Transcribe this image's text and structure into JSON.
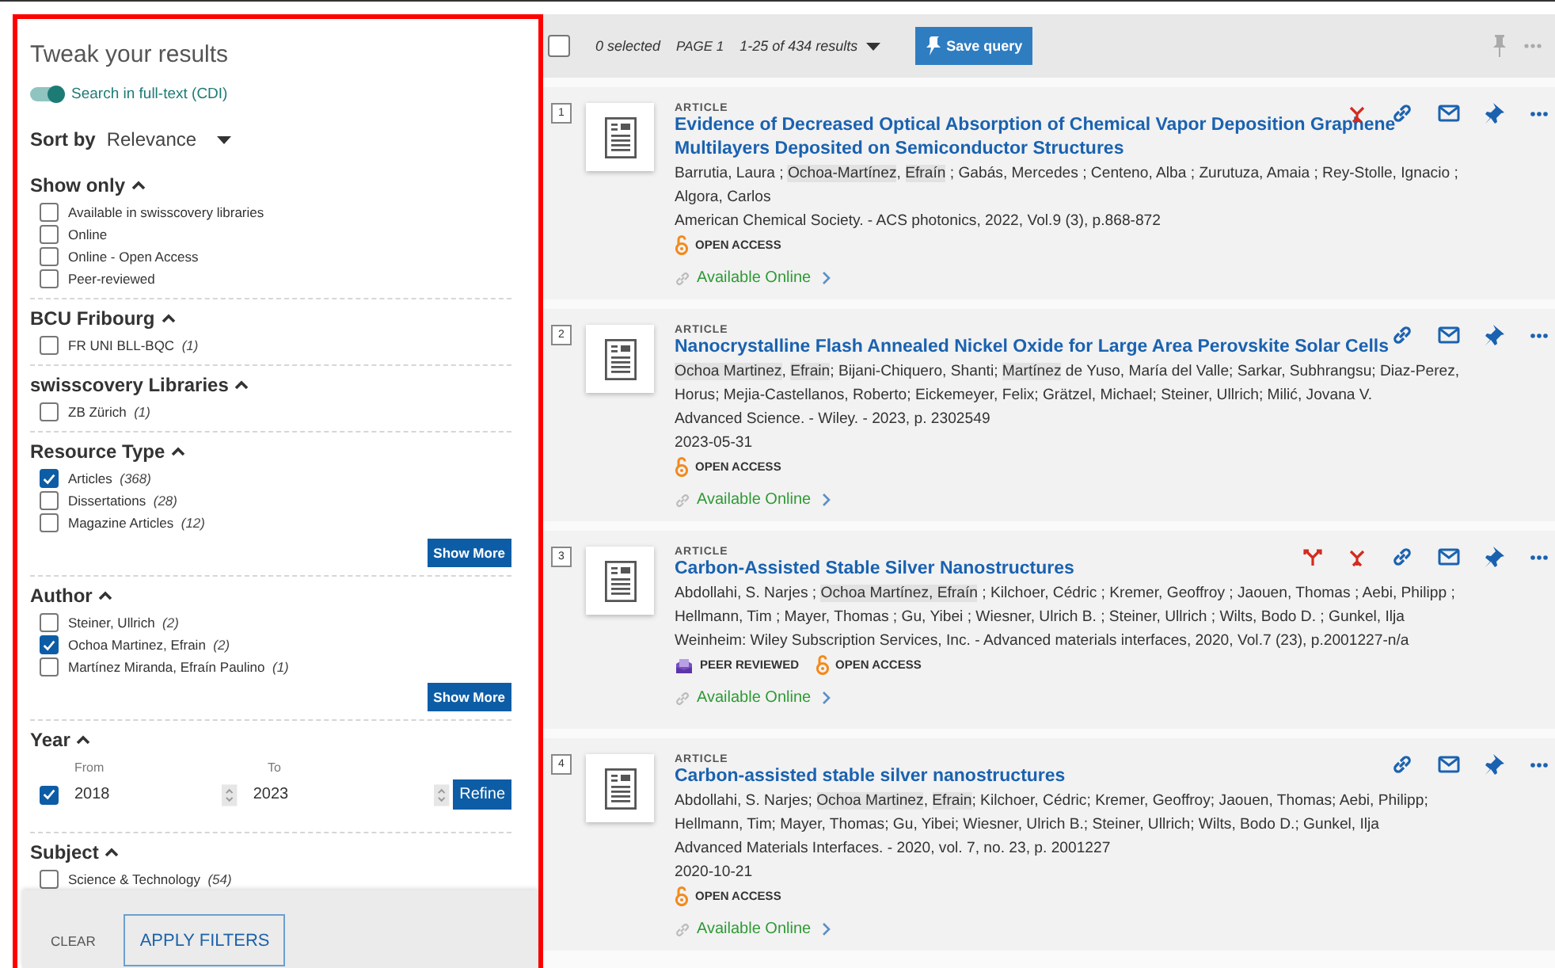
{
  "filters": {
    "title": "Tweak your results",
    "fulltext_toggle": {
      "label": "Search in full-text (CDI)",
      "on": true
    },
    "sort": {
      "label": "Sort by",
      "value": "Relevance"
    },
    "groups": [
      {
        "kind": "checklist",
        "title": "Show only",
        "expanded": true,
        "items": [
          {
            "label": "Available in swisscovery libraries",
            "checked": false
          },
          {
            "label": "Online",
            "checked": false
          },
          {
            "label": "Online - Open Access",
            "checked": false
          },
          {
            "label": "Peer-reviewed",
            "checked": false
          }
        ]
      },
      {
        "kind": "checklist",
        "title": "BCU Fribourg",
        "expanded": true,
        "items": [
          {
            "label": "FR UNI BLL-BQC",
            "count": "(1)",
            "checked": false
          }
        ]
      },
      {
        "kind": "checklist",
        "title": "swisscovery Libraries",
        "expanded": true,
        "items": [
          {
            "label": "ZB Zürich",
            "count": "(1)",
            "checked": false
          }
        ]
      },
      {
        "kind": "checklist",
        "title": "Resource Type",
        "expanded": true,
        "items": [
          {
            "label": "Articles",
            "count": "(368)",
            "checked": true
          },
          {
            "label": "Dissertations",
            "count": "(28)",
            "checked": false
          },
          {
            "label": "Magazine Articles",
            "count": "(12)",
            "checked": false
          }
        ],
        "show_more": "Show More"
      },
      {
        "kind": "checklist",
        "title": "Author",
        "expanded": true,
        "items": [
          {
            "label": "Steiner, Ullrich",
            "count": "(2)",
            "checked": false
          },
          {
            "label": "Ochoa Martinez, Efrain",
            "count": "(2)",
            "checked": true
          },
          {
            "label": "Martínez Miranda, Efraín Paulino",
            "count": "(1)",
            "checked": false
          }
        ],
        "show_more": "Show More"
      },
      {
        "kind": "year",
        "title": "Year",
        "expanded": true,
        "checked": true,
        "from_label": "From",
        "from": "2018",
        "to_label": "To",
        "to": "2023",
        "button": "Refine"
      },
      {
        "kind": "checklist",
        "title": "Subject",
        "expanded": true,
        "items": [
          {
            "label": "Science & Technology",
            "count": "(54)",
            "checked": false
          }
        ]
      }
    ],
    "footer": {
      "clear": "CLEAR",
      "apply": "APPLY FILTERS"
    }
  },
  "toolbar": {
    "all_checked": false,
    "selected": "0 selected",
    "page": "PAGE 1",
    "range": "1-25 of 434 results",
    "save": "Save query"
  },
  "results": [
    {
      "number": "1",
      "type": "ARTICLE",
      "title": "Evidence of Decreased Optical Absorption of Chemical Vapor Deposition Graphene Multilayers Deposited on Semiconductor Structures",
      "trails": [
        {
          "kind": "citing"
        }
      ],
      "authors": [
        {
          "text": "Barrutia, Laura ; ",
          "highlight": false
        },
        {
          "text": "Ochoa-Martínez",
          "highlight": true
        },
        {
          "text": ", ",
          "highlight": false
        },
        {
          "text": "Efraín",
          "highlight": true
        },
        {
          "text": " ; Gabás, Mercedes ; Centeno, Alba ; Zurutuza, Amaia ; Rey-Stolle, Ignacio ; Algora, Carlos",
          "highlight": false
        }
      ],
      "source": "American Chemical Society. - ACS photonics, 2022, Vol.9 (3), p.868-872",
      "badges": [
        {
          "kind": "open",
          "label": "OPEN ACCESS"
        }
      ],
      "link": "Available Online"
    },
    {
      "number": "2",
      "type": "ARTICLE",
      "title": "Nanocrystalline Flash Annealed Nickel Oxide for Large Area Perovskite Solar Cells",
      "authors": [
        {
          "text": "Ochoa Martinez",
          "highlight": true
        },
        {
          "text": ", ",
          "highlight": false
        },
        {
          "text": "Efrain",
          "highlight": true
        },
        {
          "text": "; Bijani-Chiquero, Shanti; ",
          "highlight": false
        },
        {
          "text": "Martínez",
          "highlight": true
        },
        {
          "text": " de Yuso, María del Valle; Sarkar, Subhrangsu; Diaz-Perez, Horus; Mejia-Castellanos, Roberto; Eickemeyer, Felix; Grätzel, Michael; Steiner, Ullrich; Milić, Jovana V.",
          "highlight": false
        }
      ],
      "source": "Advanced Science. - Wiley. - 2023, p. 2302549",
      "date": "2023-05-31",
      "badges": [
        {
          "kind": "open",
          "label": "OPEN ACCESS"
        }
      ],
      "link": "Available Online"
    },
    {
      "number": "3",
      "type": "ARTICLE",
      "title": "Carbon-Assisted Stable Silver Nanostructures",
      "trails": [
        {
          "kind": "cited"
        },
        {
          "kind": "citing"
        }
      ],
      "authors": [
        {
          "text": "Abdollahi, S. Narjes ; ",
          "highlight": false
        },
        {
          "text": "Ochoa Martínez, Efraín",
          "highlight": true
        },
        {
          "text": " ; Kilchoer, Cédric ; Kremer, Geoffroy ; Jaouen, Thomas ; Aebi, Philipp ; Hellmann, Tim ; Mayer, Thomas ; Gu, Yibei ; Wiesner, Ulrich B. ; Steiner, Ullrich ; Wilts, Bodo D. ; Gunkel, Ilja",
          "highlight": false
        }
      ],
      "source": "Weinheim: Wiley Subscription Services, Inc. - Advanced materials interfaces, 2020, Vol.7 (23), p.2001227-n/a",
      "badges": [
        {
          "kind": "peer",
          "label": "PEER REVIEWED"
        },
        {
          "kind": "open",
          "label": "OPEN ACCESS"
        }
      ],
      "link": "Available Online"
    },
    {
      "number": "4",
      "type": "ARTICLE",
      "title": "Carbon-assisted stable silver nanostructures",
      "authors": [
        {
          "text": "Abdollahi, S. Narjes; ",
          "highlight": false
        },
        {
          "text": "Ochoa Martinez",
          "highlight": true
        },
        {
          "text": ", ",
          "highlight": false
        },
        {
          "text": "Efrain",
          "highlight": true
        },
        {
          "text": "; Kilchoer, Cédric; Kremer, Geoffroy; Jaouen, Thomas; Aebi, Philipp; Hellmann, Tim; Mayer, Thomas; Gu, Yibei; Wiesner, Ulrich B.; Steiner, Ullrich; Wilts, Bodo D.; Gunkel, Ilja",
          "highlight": false
        }
      ],
      "source": "Advanced Materials Interfaces. - 2020, vol. 7, no. 23, p. 2001227",
      "date": "2020-10-21",
      "badges": [
        {
          "kind": "open",
          "label": "OPEN ACCESS"
        }
      ],
      "link": "Available Online"
    }
  ]
}
